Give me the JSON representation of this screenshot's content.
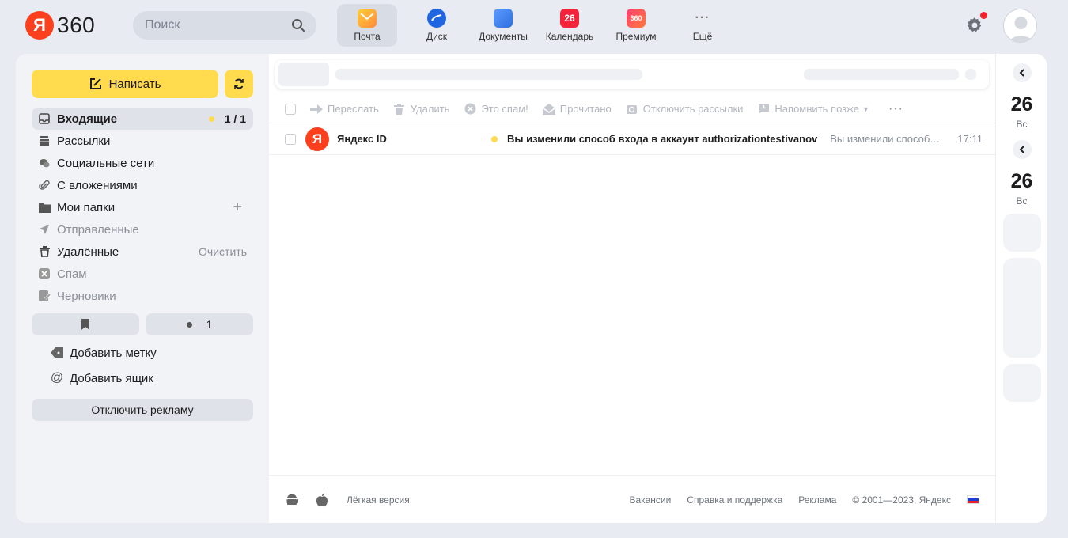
{
  "logo": {
    "letter": "Я",
    "text": "360"
  },
  "search": {
    "placeholder": "Поиск"
  },
  "services": [
    {
      "label": "Почта",
      "icon": "mail-icon"
    },
    {
      "label": "Диск",
      "icon": "disk-icon"
    },
    {
      "label": "Документы",
      "icon": "docs-icon"
    },
    {
      "label": "Календарь",
      "icon": "calendar-icon",
      "badge": "26"
    },
    {
      "label": "Премиум",
      "icon": "premium-icon",
      "badge": "360"
    },
    {
      "label": "Ещё",
      "icon": "more-icon",
      "badge": "···"
    }
  ],
  "sidebar": {
    "compose_label": "Написать",
    "folders": [
      {
        "label": "Входящие",
        "count": "1 / 1",
        "icon": "inbox-icon"
      },
      {
        "label": "Рассылки",
        "icon": "newsletters-icon"
      },
      {
        "label": "Социальные сети",
        "icon": "social-icon"
      },
      {
        "label": "С вложениями",
        "icon": "attachment-icon"
      },
      {
        "label": "Мои папки",
        "icon": "folder-icon",
        "action": "+"
      },
      {
        "label": "Отправленные",
        "icon": "sent-icon"
      },
      {
        "label": "Удалённые",
        "icon": "trash-icon",
        "action": "Очистить"
      },
      {
        "label": "Спам",
        "icon": "spam-icon"
      },
      {
        "label": "Черновики",
        "icon": "drafts-icon"
      }
    ],
    "chip_count": "1",
    "add_label": "Добавить метку",
    "add_mailbox": "Добавить ящик",
    "disable_ads": "Отключить рекламу"
  },
  "toolbar": {
    "items": [
      {
        "label": "Переслать",
        "icon": "forward-icon"
      },
      {
        "label": "Удалить",
        "icon": "delete-icon"
      },
      {
        "label": "Это спам!",
        "icon": "spam-icon"
      },
      {
        "label": "Прочитано",
        "icon": "read-icon"
      },
      {
        "label": "Отключить рассылки",
        "icon": "unsubscribe-icon"
      },
      {
        "label": "Напомнить позже",
        "icon": "remind-icon"
      }
    ],
    "more": "···"
  },
  "messages": [
    {
      "avatar_letter": "Я",
      "sender": "Яндекс ID",
      "subject": "Вы изменили способ входа в аккаунт authorizationtestivanov",
      "preview": "Вы изменили способ входа в аккаунт",
      "time": "17:11"
    }
  ],
  "footer": {
    "light_version": "Лёгкая версия",
    "links": [
      "Вакансии",
      "Справка и поддержка",
      "Реклама"
    ],
    "copyright": "© 2001—2023, Яндекс"
  },
  "right_panel": {
    "days": [
      {
        "day": "26",
        "dow": "Вс"
      },
      {
        "day": "26",
        "dow": "Вс"
      }
    ]
  },
  "colors": {
    "accent_yellow": "#ffdb4d",
    "yandex_red": "#fc3f1d",
    "background": "#e8ebf1"
  }
}
